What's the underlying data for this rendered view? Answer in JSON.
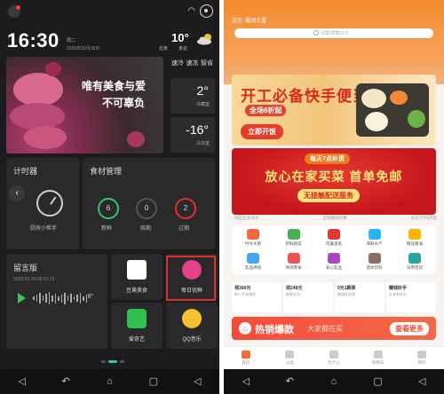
{
  "left": {
    "time": "16:30",
    "weekday": "周二",
    "date": "2020年02月18日",
    "temperature": "10°",
    "city": "北京",
    "weather": "多云",
    "photo_caption_1": "唯有美食与爱",
    "photo_caption_2": "不可辜负",
    "quick_modes": [
      "速冷",
      "速冻",
      "智省"
    ],
    "fridge_zones": [
      {
        "temp": "2°",
        "label": "冷藏室"
      },
      {
        "temp": "-16°",
        "label": "冷冻室"
      }
    ],
    "timer": {
      "title": "计时器",
      "label": "厨房小帮手"
    },
    "food": {
      "title": "食材管理",
      "items": [
        {
          "count": "6",
          "label": "新鲜",
          "color": "#3ec06a"
        },
        {
          "count": "0",
          "label": "临期",
          "color": "#8e8e93"
        },
        {
          "count": "2",
          "label": "过期",
          "color": "#e0302d"
        }
      ]
    },
    "message": {
      "title": "留言版",
      "time": "2020-01-20 09:01:13",
      "duration": "8\""
    },
    "apps": [
      {
        "icon": "豆果美食",
        "label": "豆果美食",
        "color": "#ffffff"
      },
      {
        "icon": "每日优鲜",
        "label": "每日优鲜",
        "color": "#e8428a"
      },
      {
        "icon": "爱奇艺",
        "label": "爱奇艺",
        "color": "#2fc04f"
      },
      {
        "icon": "QQ音乐",
        "label": "QQ音乐",
        "color": "#f2c230"
      }
    ]
  },
  "right": {
    "location": "送至: 鹏润大厦",
    "search_placeholder": "红颜草莓29.9",
    "banner1": {
      "title": "开工必备快手便当",
      "subtitle": "全场8折起",
      "button": "立即开饭"
    },
    "banner2": {
      "top": "每天7点补货",
      "main": "放心在家买菜 首单免邮",
      "button": "无接触配送服务"
    },
    "badges": [
      "坑位立享39元",
      "全场满减优惠",
      "天天下午5点后"
    ],
    "categories": [
      {
        "label": "时令水果",
        "color": "#f26a3e"
      },
      {
        "label": "新鲜蔬菜",
        "color": "#4caf50"
      },
      {
        "label": "肉禽蛋类",
        "color": "#e53935"
      },
      {
        "label": "海鲜水产",
        "color": "#29b6f6"
      },
      {
        "label": "精品粮油",
        "color": "#ffb300"
      },
      {
        "label": "乳品烘焙",
        "color": "#42a5f5"
      },
      {
        "label": "休闲零食",
        "color": "#ef5350"
      },
      {
        "label": "安心乳品",
        "color": "#ab47bc"
      },
      {
        "label": "酒水饮料",
        "color": "#8d6e63"
      },
      {
        "label": "日用百货",
        "color": "#26a69a"
      }
    ],
    "promos": [
      {
        "title": "领366元",
        "sub": "新人专享福利"
      },
      {
        "title": "领248元",
        "sub": "新客礼包"
      },
      {
        "title": "0元1颗果",
        "sub": "邀请好友得"
      },
      {
        "title": "赚钱好手",
        "sub": "分享有好礼"
      }
    ],
    "hot": {
      "title": "热销爆款",
      "subtitle": "大家都在买",
      "more": "查看更多"
    },
    "tabs": [
      "首页",
      "分类",
      "吃什么",
      "购物车",
      "我的"
    ]
  }
}
